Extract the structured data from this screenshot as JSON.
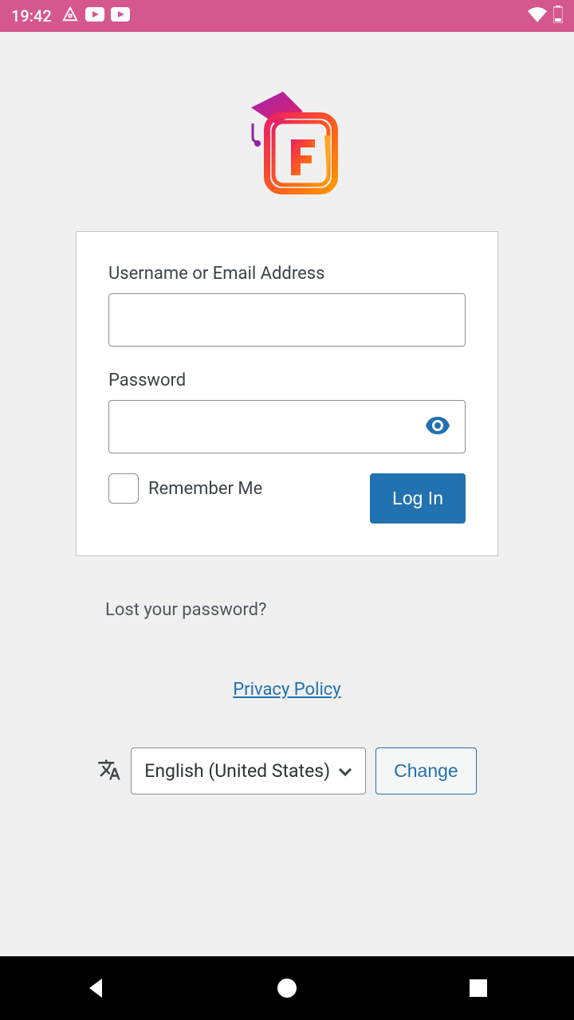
{
  "status": {
    "time": "19:42"
  },
  "form": {
    "username_label": "Username or Email Address",
    "password_label": "Password",
    "remember_label": "Remember Me",
    "login_button": "Log In"
  },
  "links": {
    "lost_password": "Lost your password?",
    "privacy": "Privacy Policy"
  },
  "language": {
    "selected": "English (United States)",
    "change_button": "Change"
  }
}
